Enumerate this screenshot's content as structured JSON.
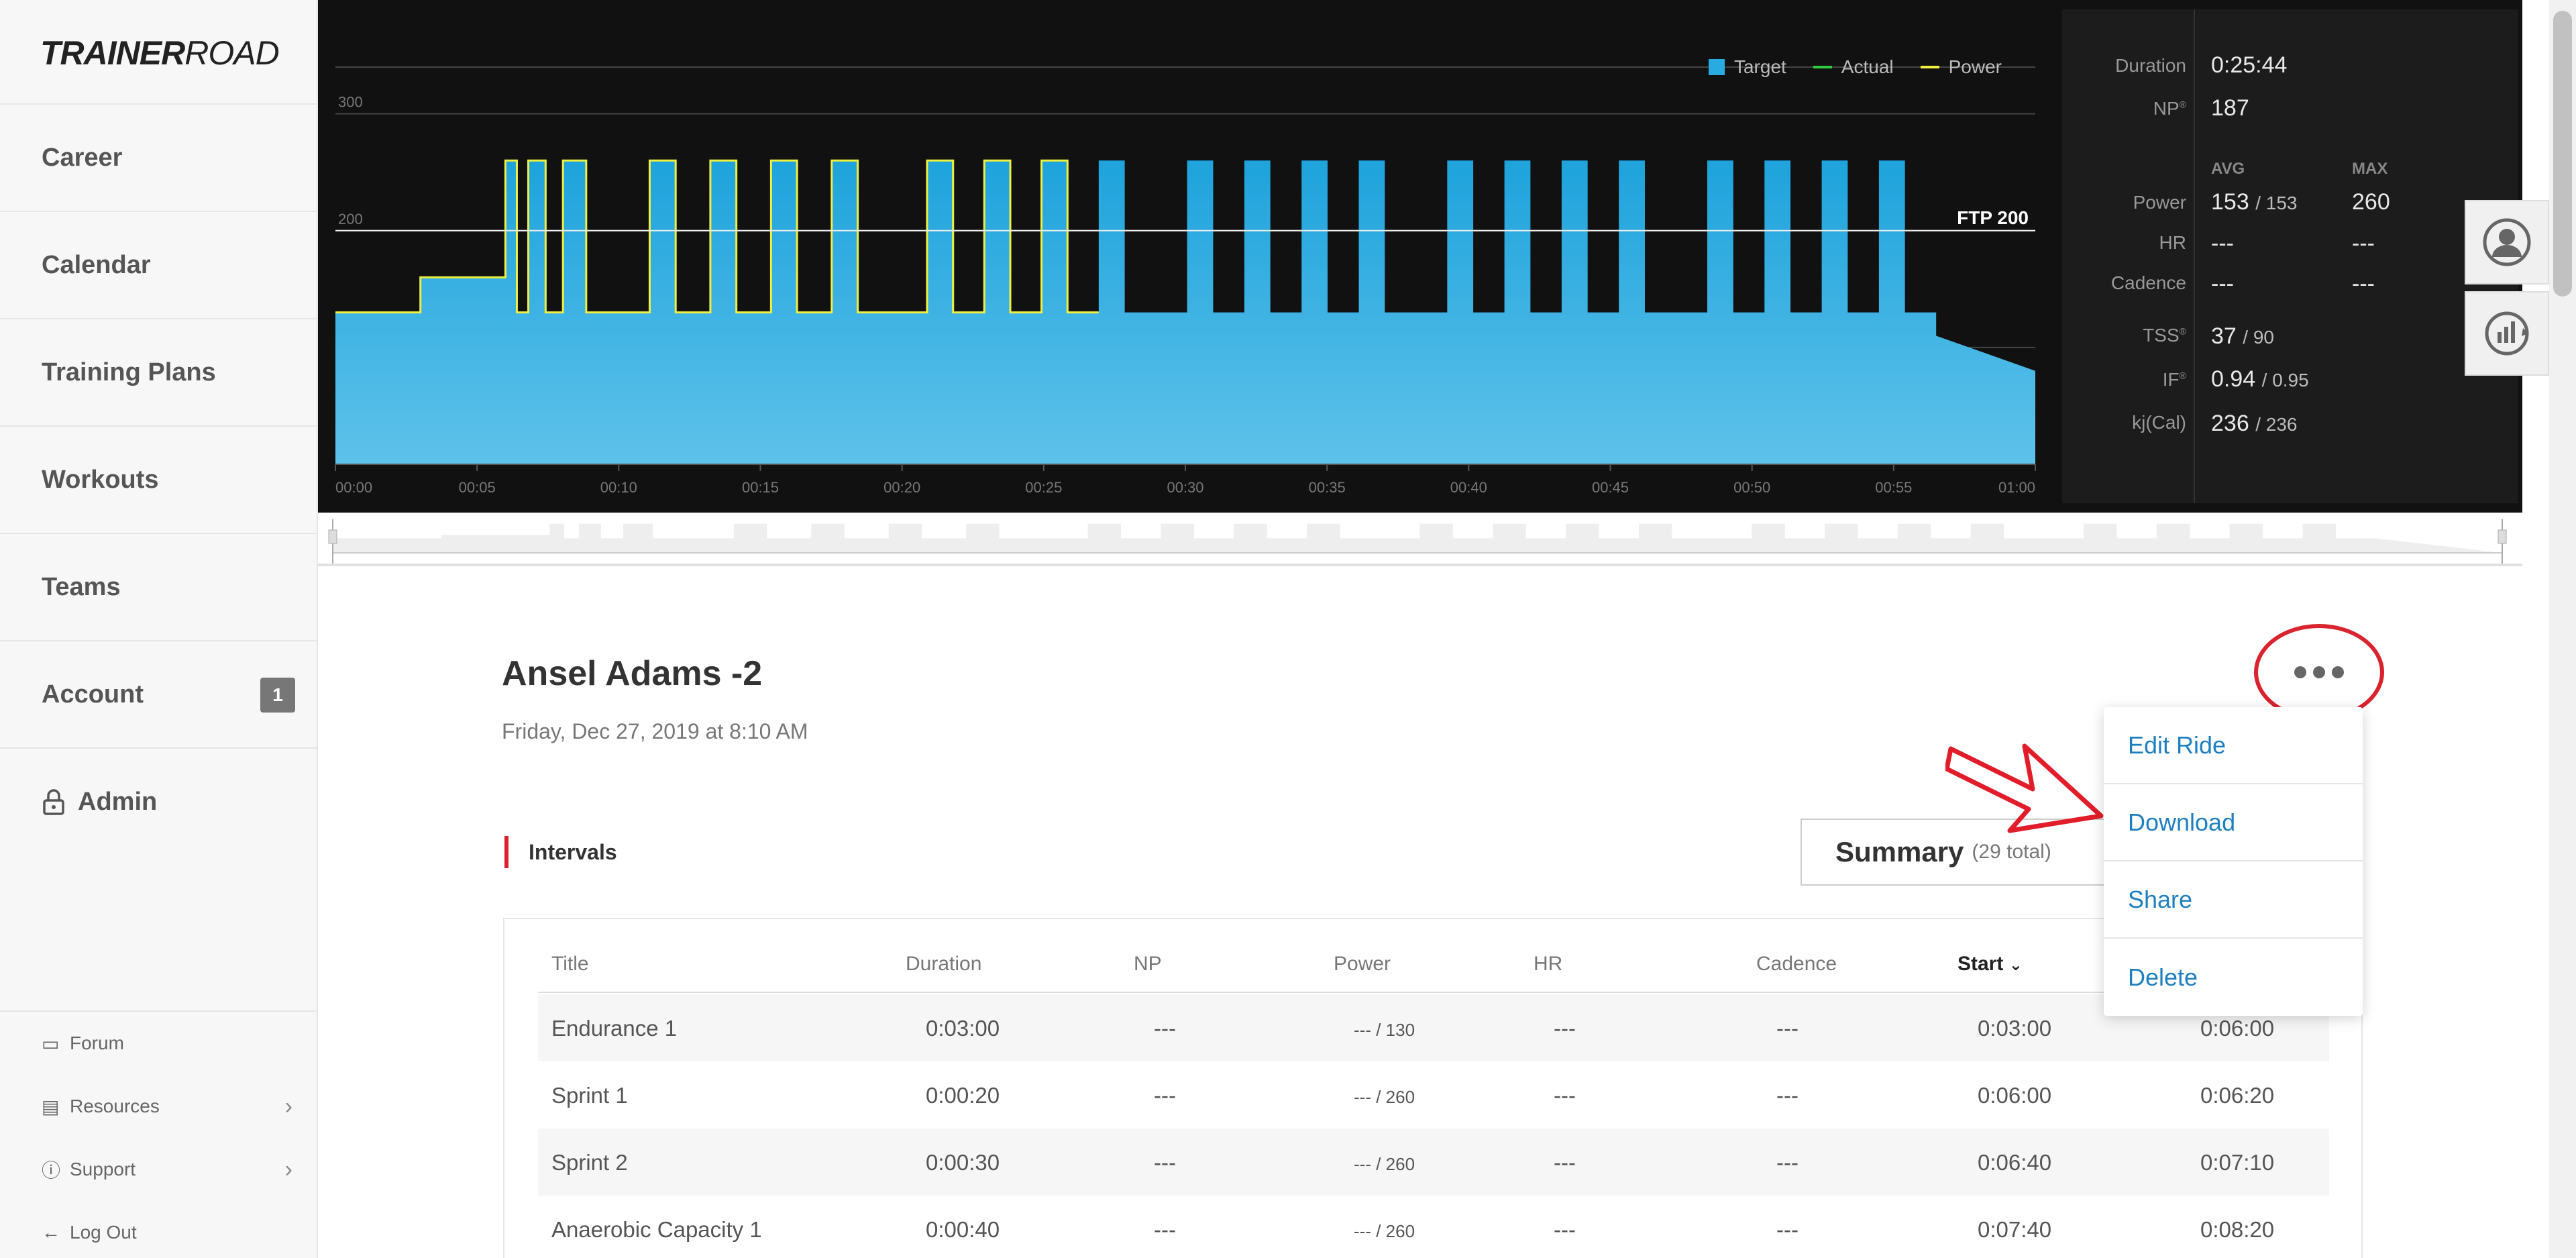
{
  "brand": {
    "part1": "TRAINER",
    "part2": "ROAD"
  },
  "sidebar": {
    "items": [
      {
        "label": "Career"
      },
      {
        "label": "Calendar"
      },
      {
        "label": "Training Plans"
      },
      {
        "label": "Workouts"
      },
      {
        "label": "Teams"
      },
      {
        "label": "Account",
        "badge": "1"
      },
      {
        "label": "Admin"
      }
    ],
    "footer": [
      {
        "label": "Forum"
      },
      {
        "label": "Resources"
      },
      {
        "label": "Support"
      },
      {
        "label": "Log Out"
      }
    ]
  },
  "chart_data": {
    "type": "area",
    "legend": [
      "Target",
      "Actual",
      "Power"
    ],
    "y_ticks": [
      "300",
      "200",
      "100"
    ],
    "ylim": [
      0,
      340
    ],
    "ftp_label": "FTP 200",
    "x_ticks": [
      "00:00",
      "00:05",
      "00:10",
      "00:15",
      "00:20",
      "00:25",
      "00:30",
      "00:35",
      "00:40",
      "00:45",
      "00:50",
      "00:55",
      "01:00"
    ],
    "colors": {
      "target": "#29abe2",
      "actual": "#2ecc40",
      "power": "#f0f040"
    }
  },
  "stats": {
    "duration_label": "Duration",
    "duration": "0:25:44",
    "np_label": "NP",
    "np": "187",
    "avg_head": "AVG",
    "max_head": "MAX",
    "power_label": "Power",
    "power_avg": "153",
    "power_avg_target": "153",
    "power_max": "260",
    "hr_label": "HR",
    "hr_avg": "---",
    "hr_max": "---",
    "cadence_label": "Cadence",
    "cadence_avg": "---",
    "cadence_max": "---",
    "tss_label": "TSS",
    "tss": "37",
    "tss_target": "90",
    "if_label": "IF",
    "if": "0.94",
    "if_target": "0.95",
    "kj_label": "kj(Cal)",
    "kj": "236",
    "kj_target": "236"
  },
  "ride": {
    "title": "Ansel Adams -2",
    "date": "Friday, Dec 27, 2019 at 8:10 AM"
  },
  "intervals": {
    "label": "Intervals",
    "summary_label": "Summary",
    "summary_count": "(29 total)"
  },
  "menu": {
    "items": [
      "Edit Ride",
      "Download",
      "Share",
      "Delete"
    ]
  },
  "table": {
    "headers": [
      "Title",
      "Duration",
      "NP",
      "Power",
      "HR",
      "Cadence",
      "Start"
    ],
    "rows": [
      {
        "title": "Endurance 1",
        "duration": "0:03:00",
        "np": "---",
        "power": "---",
        "power_target": "130",
        "hr": "---",
        "cadence": "---",
        "start": "0:03:00",
        "end": "0:06:00"
      },
      {
        "title": "Sprint 1",
        "duration": "0:00:20",
        "np": "---",
        "power": "---",
        "power_target": "260",
        "hr": "---",
        "cadence": "---",
        "start": "0:06:00",
        "end": "0:06:20"
      },
      {
        "title": "Sprint 2",
        "duration": "0:00:30",
        "np": "---",
        "power": "---",
        "power_target": "260",
        "hr": "---",
        "cadence": "---",
        "start": "0:06:40",
        "end": "0:07:10"
      },
      {
        "title": "Anaerobic Capacity 1",
        "duration": "0:00:40",
        "np": "---",
        "power": "---",
        "power_target": "260",
        "hr": "---",
        "cadence": "---",
        "start": "0:07:40",
        "end": "0:08:20"
      }
    ]
  }
}
